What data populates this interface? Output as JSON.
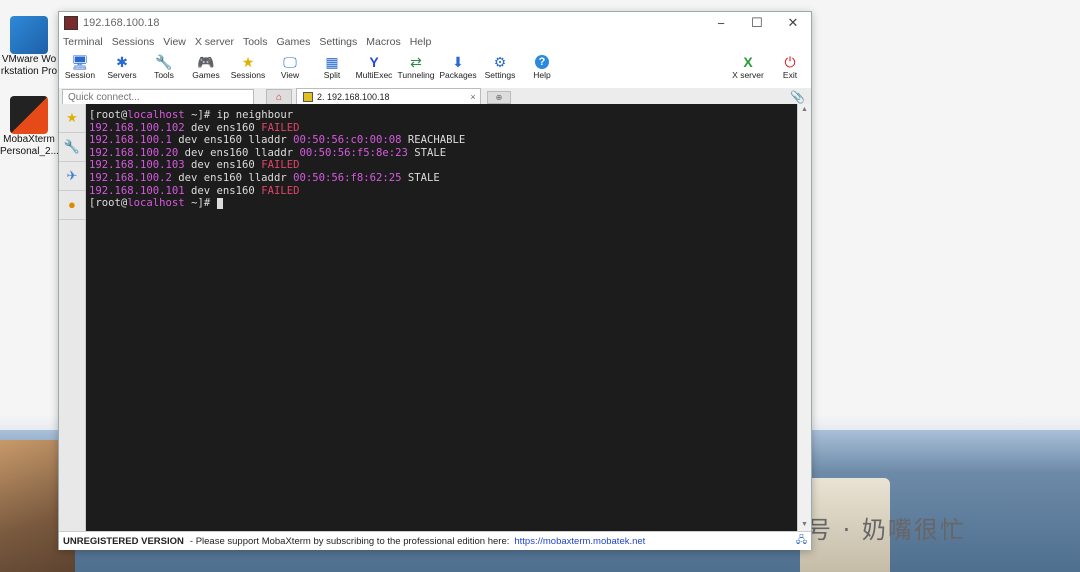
{
  "desktop": {
    "icons": [
      {
        "label": "VMware Wo\nrkstation Pro"
      },
      {
        "label": "MobaXterm\nPersonal_2..."
      }
    ],
    "watermark": "公众号 · 奶嘴很忙"
  },
  "window": {
    "title": "192.168.100.18",
    "controls": {
      "minimize": "−",
      "maximize": "☐",
      "close": "✕"
    }
  },
  "menu": [
    "Terminal",
    "Sessions",
    "View",
    "X server",
    "Tools",
    "Games",
    "Settings",
    "Macros",
    "Help"
  ],
  "toolbar": {
    "buttons": [
      {
        "label": "Session",
        "icon": "🖥"
      },
      {
        "label": "Servers",
        "icon": "✱"
      },
      {
        "label": "Tools",
        "icon": "🔧"
      },
      {
        "label": "Games",
        "icon": "🎮"
      },
      {
        "label": "Sessions",
        "icon": "★"
      },
      {
        "label": "View",
        "icon": "🖵"
      },
      {
        "label": "Split",
        "icon": "▦"
      },
      {
        "label": "MultiExec",
        "icon": "Y"
      },
      {
        "label": "Tunneling",
        "icon": "⇄"
      },
      {
        "label": "Packages",
        "icon": "⬇"
      },
      {
        "label": "Settings",
        "icon": "⚙"
      },
      {
        "label": "Help",
        "icon": "?"
      }
    ],
    "right": [
      {
        "label": "X server",
        "icon": "X"
      },
      {
        "label": "Exit",
        "icon": "⏻"
      }
    ]
  },
  "tabs": {
    "quick_connect_placeholder": "Quick connect...",
    "session_tab": "2. 192.168.100.18",
    "session_tab_close": "×"
  },
  "terminal": {
    "prompt_user": "root",
    "prompt_host": "localhost",
    "prompt_dir": "~",
    "command": "ip neighbour",
    "entries": [
      {
        "ip": "192.168.100.102",
        "mid": " dev ens160 ",
        "mac": "",
        "state": "FAILED",
        "failed": true
      },
      {
        "ip": "192.168.100.1",
        "mid": " dev ens160 lladdr ",
        "mac": "00:50:56:c0:00:08",
        "state": " REACHABLE",
        "failed": false
      },
      {
        "ip": "192.168.100.20",
        "mid": " dev ens160 lladdr ",
        "mac": "00:50:56:f5:8e:23",
        "state": " STALE",
        "failed": false
      },
      {
        "ip": "192.168.100.103",
        "mid": " dev ens160 ",
        "mac": "",
        "state": "FAILED",
        "failed": true
      },
      {
        "ip": "192.168.100.2",
        "mid": " dev ens160 lladdr ",
        "mac": "00:50:56:f8:62:25",
        "state": " STALE",
        "failed": false
      },
      {
        "ip": "192.168.100.101",
        "mid": " dev ens160 ",
        "mac": "",
        "state": "FAILED",
        "failed": true
      }
    ]
  },
  "status": {
    "registration": "UNREGISTERED VERSION",
    "message": "-  Please support MobaXterm by subscribing to the professional edition here:",
    "link": "https://mobaxterm.mobatek.net"
  }
}
